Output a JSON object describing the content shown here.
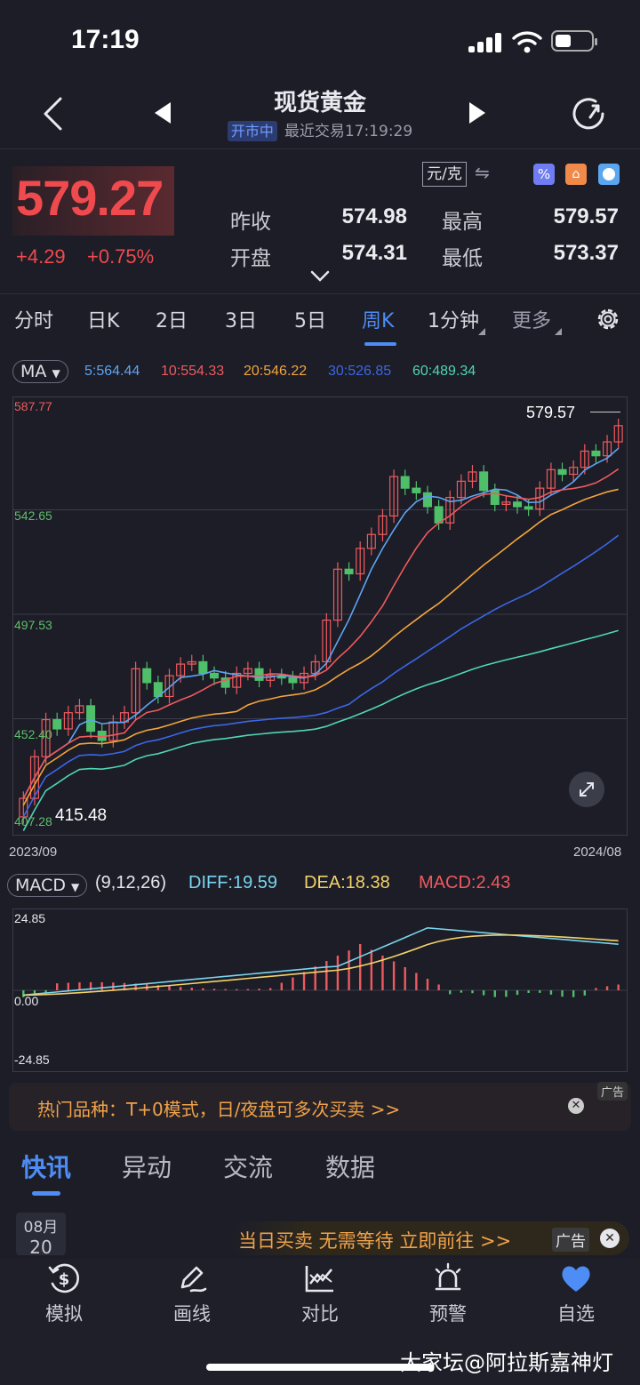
{
  "status": {
    "time": "17:19"
  },
  "nav": {
    "title": "现货黄金",
    "market_state": "开市中",
    "last_trade": "最近交易17:19:29"
  },
  "price": {
    "last": "579.27",
    "change": "+4.29",
    "change_pct": "+0.75%",
    "unit": "元/克",
    "prev_close_label": "昨收",
    "prev_close": "574.98",
    "high_label": "最高",
    "high": "579.57",
    "open_label": "开盘",
    "open": "574.31",
    "low_label": "最低",
    "low": "573.37"
  },
  "tabs": [
    "分时",
    "日K",
    "2日",
    "3日",
    "5日",
    "周K",
    "1分钟",
    "更多"
  ],
  "active_tab": "周K",
  "ma": {
    "indicator": "MA",
    "items": [
      {
        "label": "5:564.44",
        "color": "#5ea5f2"
      },
      {
        "label": "10:554.33",
        "color": "#ef5a5e"
      },
      {
        "label": "20:546.22",
        "color": "#f3a43c"
      },
      {
        "label": "30:526.85",
        "color": "#3b67e6"
      },
      {
        "label": "60:489.34",
        "color": "#4fd6b4"
      }
    ]
  },
  "kline": {
    "y_labels": [
      "587.77",
      "542.65",
      "497.53",
      "452.40",
      "407.28"
    ],
    "high_marker": "579.57",
    "low_marker": "415.48",
    "x_start": "2023/09",
    "x_end": "2024/08"
  },
  "macd": {
    "indicator": "MACD",
    "params": "(9,12,26)",
    "diff": "DIFF:19.59",
    "dea": "DEA:18.38",
    "macd": "MACD:2.43",
    "y_labels": [
      "24.85",
      "0.00",
      "-24.85"
    ]
  },
  "ad1": {
    "text": "热门品种：T+0模式，日/夜盘可多次买卖 >>",
    "tag": "广告"
  },
  "news_tabs": [
    "快讯",
    "异动",
    "交流",
    "数据"
  ],
  "news": {
    "month": "08月",
    "day": "20"
  },
  "ad2": {
    "text": "当日买卖 无需等待 立即前往 >>",
    "tag": "广告"
  },
  "bottom_nav": [
    "模拟",
    "画线",
    "对比",
    "预警",
    "自选"
  ],
  "watermark": "大家坛@阿拉斯嘉神灯"
}
